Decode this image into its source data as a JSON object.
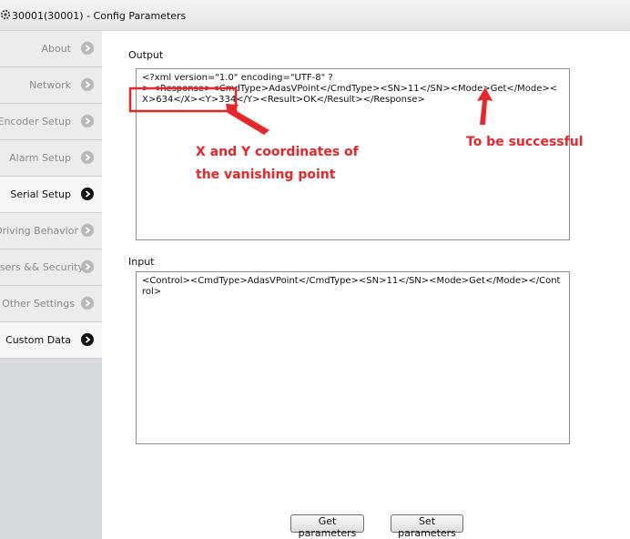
{
  "window": {
    "title": "30001(30001) - Config Parameters",
    "icon": "app-gear-icon"
  },
  "sidebar": {
    "items": [
      {
        "label": "About",
        "active": false
      },
      {
        "label": "Network",
        "active": false
      },
      {
        "label": "Encoder Setup",
        "active": false
      },
      {
        "label": "Alarm Setup",
        "active": false
      },
      {
        "label": "Serial Setup",
        "active": true
      },
      {
        "label": "Driving Behavior",
        "active": false
      },
      {
        "label": "Users && Security",
        "active": false
      },
      {
        "label": "Other Settings",
        "active": false
      },
      {
        "label": "Custom Data",
        "active": true
      }
    ]
  },
  "output": {
    "label": "Output",
    "value": "<?xml version=\"1.0\" encoding=\"UTF-8\" ?\n> <Response><CmdType>AdasVPoint</CmdType><SN>11</SN><Mode>Get</Mode><X>634</X><Y>334</Y><Result>OK</Result></Response>"
  },
  "input": {
    "label": "Input",
    "value": "<Control><CmdType>AdasVPoint</CmdType><SN>11</SN><Mode>Get</Mode></Control>"
  },
  "buttons": {
    "get": "Get parameters",
    "set": "Set parameters"
  },
  "annotations": {
    "coords_line1": "X and Y coordinates of",
    "coords_line2": "the vanishing point",
    "success": "To be successful",
    "color": "#e8262a"
  }
}
